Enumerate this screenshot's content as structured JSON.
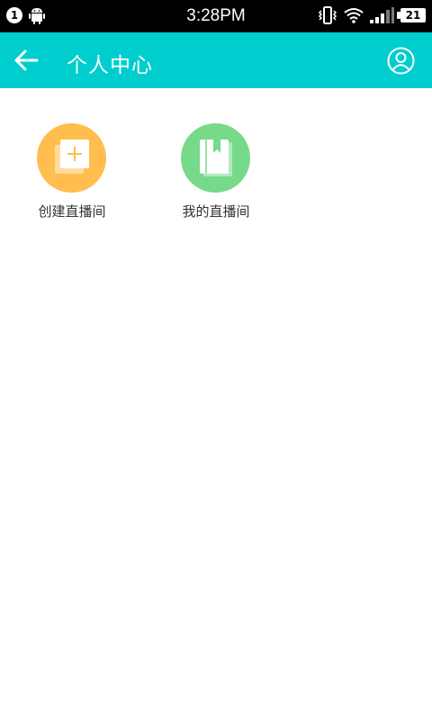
{
  "status_bar": {
    "notification_count": "1",
    "time": "3:28PM",
    "battery_level": "21"
  },
  "app_bar": {
    "title": "个人中心"
  },
  "menu": {
    "items": [
      {
        "label": "创建直播间",
        "icon": "add-square-icon",
        "color": "#ffbe4d"
      },
      {
        "label": "我的直播间",
        "icon": "book-icon",
        "color": "#76da8a"
      }
    ]
  },
  "colors": {
    "primary": "#00cdcd"
  }
}
